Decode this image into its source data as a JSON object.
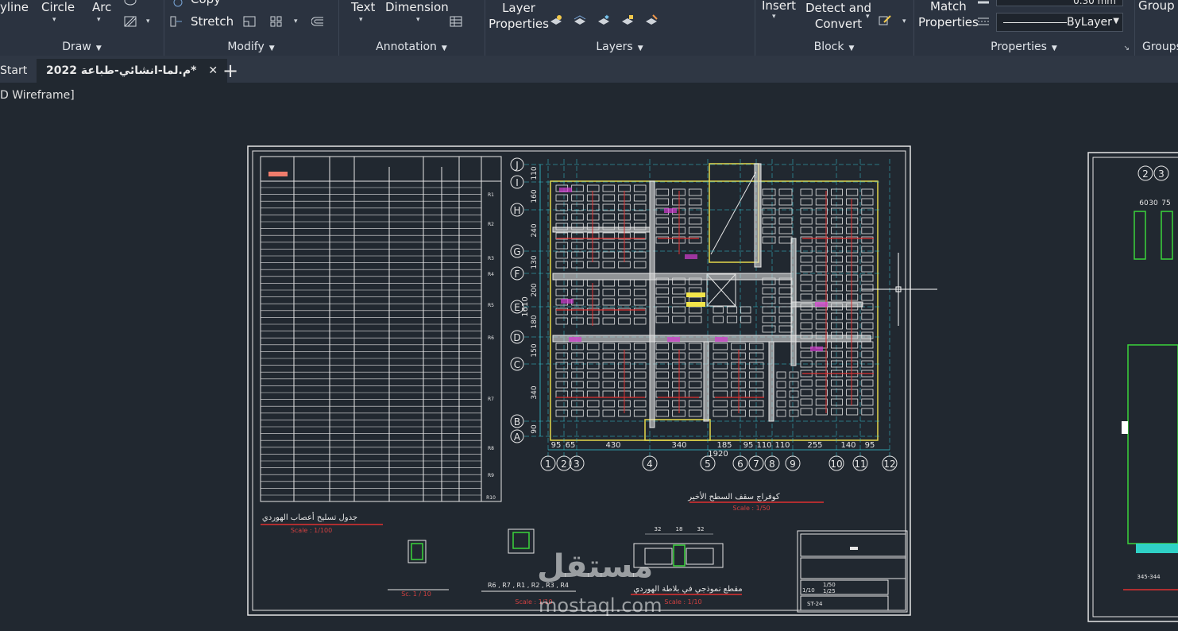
{
  "ribbon": {
    "draw": {
      "polyline": "yline",
      "circle": "Circle",
      "arc": "Arc",
      "title": "Draw"
    },
    "modify": {
      "copy": "Copy",
      "stretch": "Stretch",
      "title": "Modify"
    },
    "annotation": {
      "text": "Text",
      "dimension": "Dimension",
      "title": "Annotation"
    },
    "layers": {
      "layer_properties_1": "Layer",
      "layer_properties_2": "Properties",
      "title": "Layers"
    },
    "block": {
      "insert": "Insert",
      "detect_1": "Detect and",
      "detect_2": "Convert",
      "title": "Block"
    },
    "properties": {
      "match_1": "Match",
      "match_2": "Properties",
      "lineweight": "0.30 mm",
      "linetype": "ByLayer",
      "title": "Properties"
    },
    "groups": {
      "group": "Group",
      "title": "Groups"
    }
  },
  "tabs": {
    "start": "Start",
    "active": "م.لما-انشائي-طباعة 2022*",
    "new": "+"
  },
  "viewport": {
    "label": "D Wireframe]"
  },
  "drawing": {
    "plan_title": "كوفراج سقف السطح الأخير",
    "plan_scale": "Scale : 1/50",
    "table_title": "جدول تسليح أعصاب الهوردي",
    "table_scale": "Scale : 1/100",
    "section_title": "مقطع نموذجي في بلاطة الهوردي",
    "section_scale": "Scale : 1/10",
    "detail_scale": "Sc. 1 / 10",
    "detail2_scale": "Scale : 1/10",
    "rib_labels": "R6 , R7 , R1 , R2 , R3 , R4",
    "top_dims": [
      "32",
      "18",
      "32"
    ],
    "grid_letters": [
      "J",
      "I",
      "H",
      "G",
      "F",
      "E",
      "D",
      "C",
      "B",
      "A"
    ],
    "grid_numbers": [
      "1",
      "2",
      "3",
      "4",
      "5",
      "6",
      "7",
      "8",
      "9",
      "10",
      "11",
      "12"
    ],
    "bottom_dims": [
      "95",
      "65",
      "430",
      "340",
      "185",
      "95",
      "110",
      "110",
      "255",
      "140",
      "95"
    ],
    "total_dim": "1920",
    "left_dims": [
      "110",
      "160",
      "240",
      "130",
      "200",
      "180",
      "150",
      "340",
      "90"
    ],
    "left_total": "1610",
    "rib_ids": [
      "R1",
      "R2",
      "R3",
      "R4",
      "R5",
      "R6",
      "R7",
      "R8",
      "R9",
      "R10"
    ],
    "title_block": {
      "scale1": "1/50",
      "scale2": "1/25",
      "scale3": "1/10",
      "sheet": "ST-24"
    },
    "right_dims": [
      "60",
      "30",
      "75"
    ],
    "right_labels": [
      "2",
      "3"
    ],
    "right_caption": "345-344"
  },
  "watermark": {
    "arabic": "مستقل",
    "latin": "mostaql.com"
  },
  "colors": {
    "canvas": "#212830",
    "ribbon": "#2b3340",
    "tabbar": "#2f3744"
  }
}
